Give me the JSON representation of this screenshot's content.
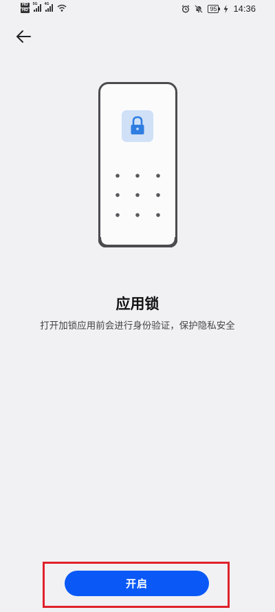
{
  "status_bar": {
    "sim1": "HD",
    "sim2": "HD",
    "network1": "5G",
    "network2": "4G",
    "battery": "95",
    "time": "14:36",
    "icons": [
      "alarm-icon",
      "mute-icon",
      "charging-icon",
      "wifi-icon",
      "signal-icon"
    ]
  },
  "header": {
    "back_icon": "back-arrow-icon"
  },
  "illustration": {
    "icon": "lock-icon",
    "pattern_dots": 9
  },
  "main": {
    "title": "应用锁",
    "description": "打开加锁应用前会进行身份验证，保护隐私安全"
  },
  "footer": {
    "enable_label": "开启"
  },
  "colors": {
    "background": "#f1f1f3",
    "accent": "#0a59f7",
    "highlight": "#e0202a",
    "lock_tile": "#cfe0f7",
    "lock_icon": "#2f7de1"
  }
}
